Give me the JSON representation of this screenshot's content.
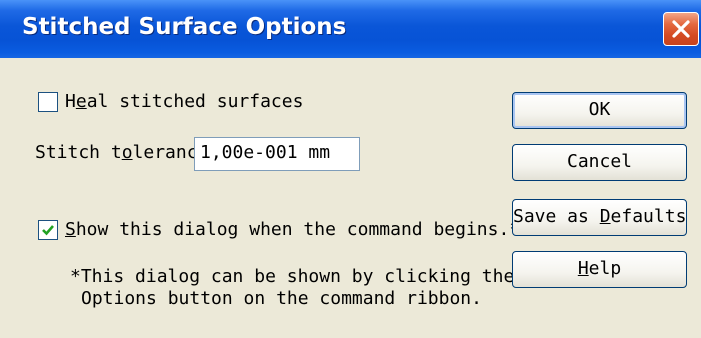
{
  "dialog": {
    "title": "Stitched Surface Options"
  },
  "options": {
    "heal_checkbox": {
      "checked": false,
      "label_pre": "H",
      "label_access": "e",
      "label_post": "al stitched surfaces"
    },
    "tolerance": {
      "label_pre": "Stitch t",
      "label_access": "o",
      "label_post": "lerance :",
      "value": "1,00e-001 mm"
    },
    "show_dialog_checkbox": {
      "checked": true,
      "label_access": "S",
      "label_post": "how this dialog when the command begins.*"
    },
    "note": {
      "line1": "*This dialog can be shown by clicking the",
      "line2": "Options button on the command ribbon."
    }
  },
  "buttons": {
    "ok": "OK",
    "cancel": "Cancel",
    "save_defaults_pre": "Save as ",
    "save_defaults_access": "D",
    "save_defaults_post": "efaults",
    "help_access": "H",
    "help_post": "elp"
  },
  "icons": {
    "close": "close-icon",
    "check": "checkmark-icon"
  },
  "colors": {
    "titlebar": "#0a56d8",
    "close_button": "#d44a22",
    "dialog_background": "#ece9d8",
    "checkmark": "#21a121"
  }
}
